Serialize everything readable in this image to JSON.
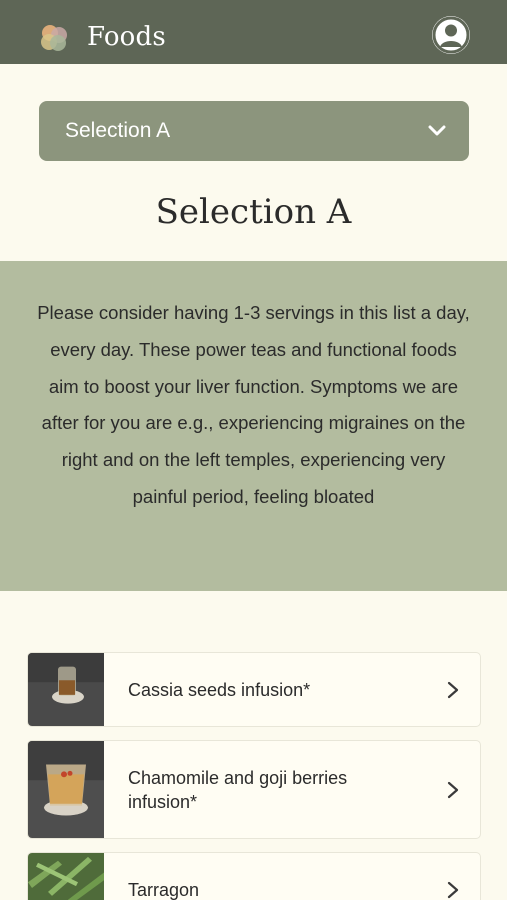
{
  "header": {
    "app_title": "Foods",
    "logo_icon": "petals-logo-icon",
    "profile_icon": "user-profile-icon"
  },
  "selector": {
    "selected_value": "Selection A",
    "chevron_icon": "chevron-down-icon"
  },
  "page": {
    "title": "Selection A"
  },
  "info": {
    "text": "Please consider having 1-3 servings in this list a day, every day. These power teas and functional foods aim to boost your liver function. Symptoms we are after for you are e.g., experiencing migraines on the right and on the left temples, experiencing very painful period, feeling bloated"
  },
  "foods": [
    {
      "name": "Cassia seeds infusion*",
      "thumbnail": "cassia-seeds-infusion-photo"
    },
    {
      "name": "Chamomile and goji berries infusion*",
      "thumbnail": "chamomile-goji-infusion-photo"
    },
    {
      "name": "Tarragon",
      "thumbnail": "tarragon-photo"
    }
  ],
  "colors": {
    "header_bg": "#5e6656",
    "select_bg": "#8c957d",
    "info_bg": "#b3bc9f",
    "page_bg": "#fcfaee"
  }
}
